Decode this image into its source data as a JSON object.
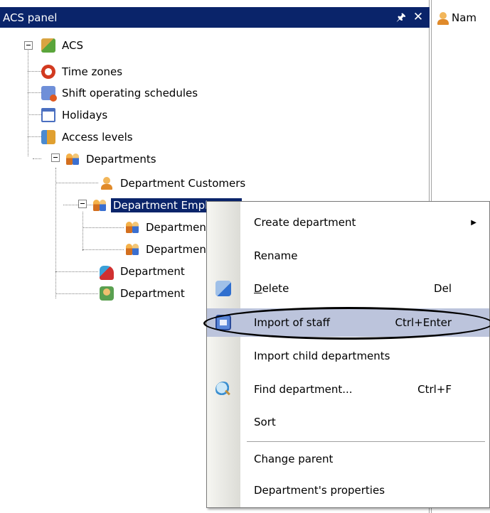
{
  "panel": {
    "title": "ACS panel",
    "pin_glyph": "⢑",
    "close_glyph": "✕"
  },
  "right_panel": {
    "column_header": "Nam"
  },
  "tree": {
    "root": "ACS",
    "items": [
      {
        "label": "Time zones",
        "icon": "clock-icon"
      },
      {
        "label": "Shift operating schedules",
        "icon": "shift-schedule-icon"
      },
      {
        "label": "Holidays",
        "icon": "calendar-icon"
      },
      {
        "label": "Access levels",
        "icon": "access-level-icon"
      },
      {
        "label": "Departments",
        "icon": "people-icon"
      },
      {
        "label": "Department Customers",
        "icon": "person-icon"
      },
      {
        "label": "Department Employees",
        "visible": "Department Employees",
        "icon": "people-icon"
      },
      {
        "label": "Department",
        "icon": "people-icon"
      },
      {
        "label": "Department",
        "icon": "people-icon"
      },
      {
        "label": "Department",
        "icon": "car-icon"
      },
      {
        "label": "Department",
        "icon": "user-card-icon"
      }
    ]
  },
  "context_menu": {
    "items": [
      {
        "label": "Create department",
        "shortcut": "",
        "submenu": true
      },
      {
        "label": "Rename",
        "shortcut": ""
      },
      {
        "label": "Delete",
        "shortcut": "Del",
        "underline": "D"
      },
      {
        "label": "Import of staff",
        "shortcut": "Ctrl+Enter"
      },
      {
        "label": "Import child departments",
        "shortcut": ""
      },
      {
        "label": "Find department...",
        "shortcut": "Ctrl+F"
      },
      {
        "label": "Sort",
        "shortcut": ""
      },
      {
        "label": "Change parent",
        "shortcut": ""
      },
      {
        "label": "Department's properties",
        "shortcut": ""
      }
    ],
    "submenu_arrow": "▶"
  },
  "colors": {
    "title_bar": "#0a246a",
    "selection": "#0a246a",
    "menu_highlight": "#bcc4dc"
  }
}
